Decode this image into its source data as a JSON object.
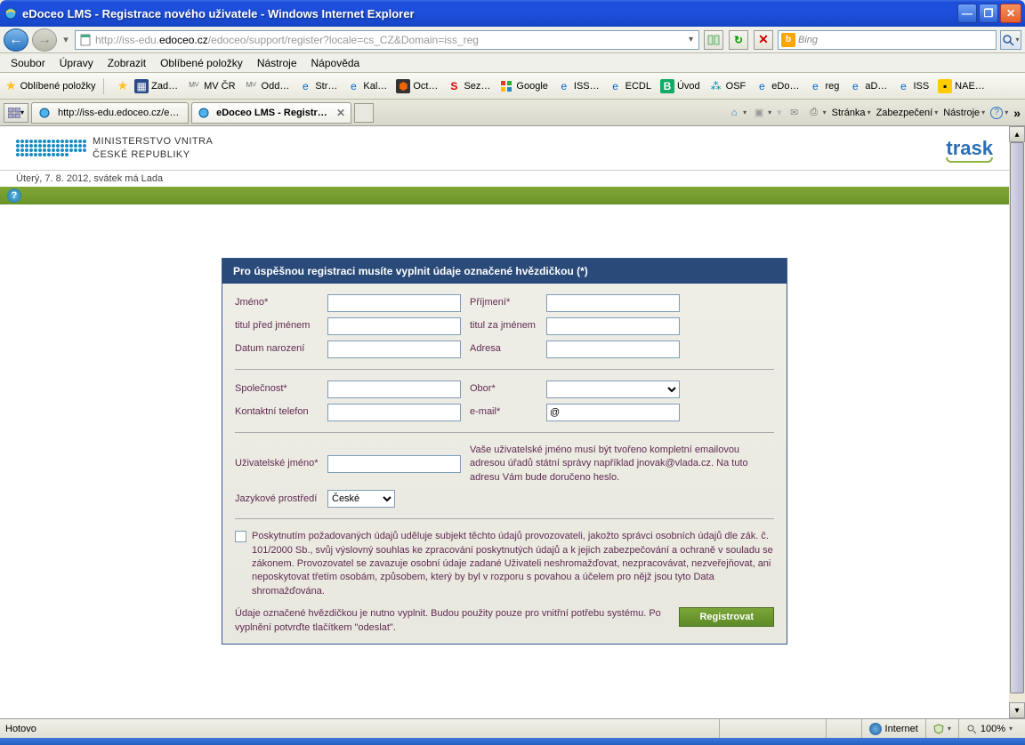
{
  "window": {
    "title": "eDoceo LMS - Registrace nového uživatele - Windows Internet Explorer"
  },
  "address": {
    "prefix": "http://iss-edu.",
    "domain": "edoceo.cz",
    "suffix": "/edoceo/support/register?locale=cs_CZ&Domain=iss_reg"
  },
  "search": {
    "engine": "Bing"
  },
  "menu": [
    "Soubor",
    "Úpravy",
    "Zobrazit",
    "Oblíbené položky",
    "Nástroje",
    "Nápověda"
  ],
  "favbar_label": "Oblíbené položky",
  "fav_items": [
    "Zad…",
    "MV ČR",
    "Odd…",
    "Str…",
    "Kal…",
    "Oct…",
    "Sez…",
    "Google",
    "ISS…",
    "ECDL",
    "Úvod",
    "OSF",
    "eDo…",
    "reg",
    "aD…",
    "ISS",
    "NAE…"
  ],
  "tabs": {
    "t1": "http://iss-edu.edoceo.cz/ed…",
    "t2": "eDoceo LMS - Registrace …"
  },
  "cmdbar": {
    "page": "Stránka",
    "safety": "Zabezpečení",
    "tools": "Nástroje"
  },
  "header": {
    "line1": "MINISTERSTVO VNITRA",
    "line2": "ČESKÉ REPUBLIKY",
    "brand": "trask",
    "date": "Úterý, 7. 8. 2012, svátek má Lada"
  },
  "form": {
    "title": "Pro úspěšnou registraci musíte vyplnit údaje označené hvězdičkou (*)",
    "labels": {
      "jmeno": "Jméno*",
      "prijmeni": "Příjmení*",
      "titul_pred": "titul před jménem",
      "titul_za": "titul za jménem",
      "datum": "Datum narození",
      "adresa": "Adresa",
      "spolecnost": "Společnost*",
      "obor": "Obor*",
      "telefon": "Kontaktní telefon",
      "email": "e-mail*",
      "uzjmeno": "Uživatelské jméno*",
      "jazyk": "Jazykové prostředí"
    },
    "email_value": "@",
    "jazyk_value": "České",
    "hint": "Vaše uživatelské jméno musí být tvořeno kompletní emailovou adresou úřadů státní správy například jnovak@vlada.cz. Na tuto adresu Vám bude doručeno heslo.",
    "consent": "Poskytnutím požadovaných údajů uděluje subjekt těchto údajů provozovateli, jakožto správci osobních údajů dle zák. č. 101/2000 Sb., svůj výslovný souhlas ke zpracování poskytnutých údajů a k jejich zabezpečování a ochraně v souladu se zákonem. Provozovatel se zavazuje osobní údaje zadané Uživateli neshromažďovat, nezpracovávat, nezveřejňovat, ani neposkytovat třetím osobám, způsobem, který by byl v rozporu s povahou a účelem pro nějž jsou tyto Data shromažďována.",
    "footer_note": "Údaje označené hvězdičkou je nutno vyplnit. Budou použity pouze pro vnitřní potřebu systému. Po vyplnění potvrďte tlačítkem \"odeslat\".",
    "submit": "Registrovat"
  },
  "status": {
    "left": "Hotovo",
    "zone": "Internet",
    "zoom": "100%"
  }
}
